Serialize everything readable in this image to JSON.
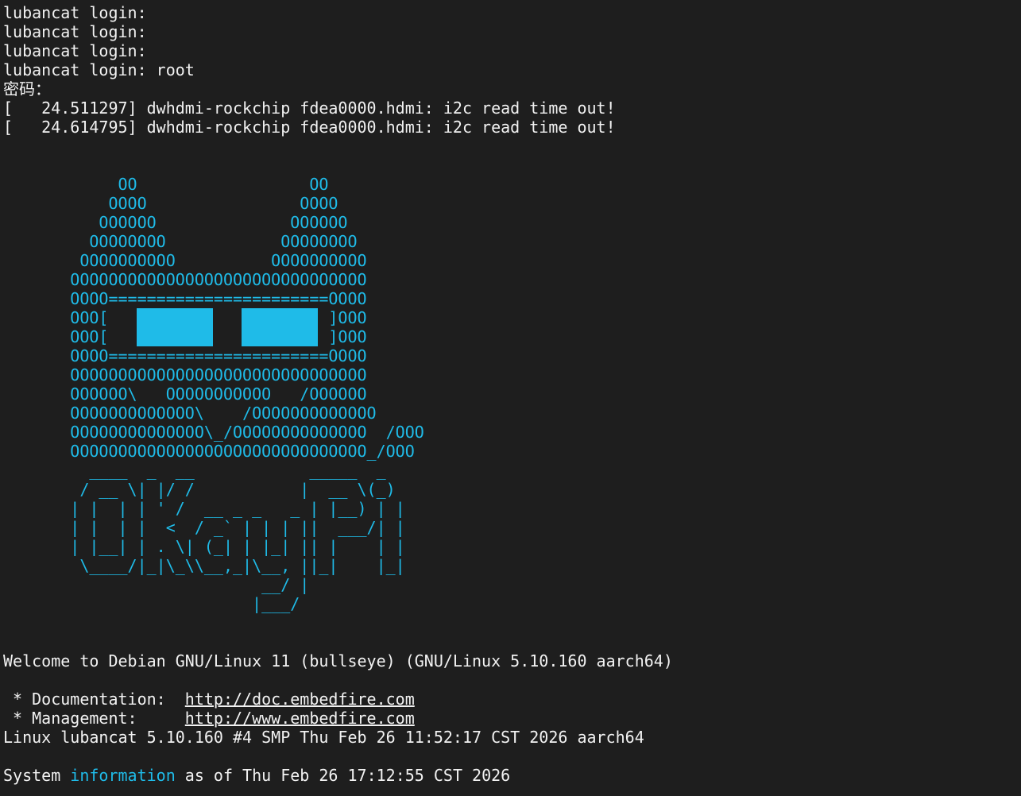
{
  "login": {
    "lines": [
      "lubancat login:",
      "lubancat login:",
      "lubancat login:",
      "lubancat login: root",
      "密码：",
      "[   24.511297] dwhdmi-rockchip fdea0000.hdmi: i2c read time out!",
      "[   24.614795] dwhdmi-rockchip fdea0000.hdmi: i2c read time out!"
    ]
  },
  "logo": {
    "color": "#1fbbe8",
    "lines": [
      "            OO                  OO",
      "           OOOO                OOOO",
      "          OOOOOO              OOOOOO",
      "         OOOOOOOO            OOOOOOOO",
      "        OOOOOOOOOO          OOOOOOOOOO",
      "       OOOOOOOOOOOOOOOOOOOOOOOOOOOOOOO",
      "       OOOO=======================OOOO",
      "       OOO[                       ]OOO",
      "       OOO[                       ]OOO",
      "       OOOO=======================OOOO",
      "       OOOOOOOOOOOOOOOOOOOOOOOOOOOOOOO",
      "       OOOOOO\\   OOOOOOOOOOO   /OOOOOO",
      "       OOOOOOOOOOOOO\\    /OOOOOOOOOOOOO",
      "       OOOOOOOOOOOOOO\\_/OOOOOOOOOOOOOO  /OOO",
      "       OOOOOOOOOOOOOOOOOOOOOOOOOOOOOOO_/OOO",
      "         ____  _  __            _____  _",
      "        / __ \\| |/ /           |  __ \\(_)",
      "       | |  | | ' /  __ _ _   _ | |__) | |",
      "       | |  | |  <  / _` | | | ||  ___/| |",
      "       | |__| | . \\| (_| | |_| || |    | |",
      "        \\____/|_|\\_\\\\__,_|\\__, ||_|    |_|",
      "                           __/ |",
      "                          |___/"
    ]
  },
  "welcome": {
    "text": "Welcome to Debian GNU/Linux 11 (bullseye) (GNU/Linux 5.10.160 aarch64)",
    "documentation_label": " * Documentation:  ",
    "documentation_url": "http://doc.embedfire.com",
    "management_label": " * Management:     ",
    "management_url": "http://www.embedfire.com",
    "uname": "Linux lubancat 5.10.160 #4 SMP Thu Feb 26 11:52:17 CST 2026 aarch64",
    "sysinfo_prefix": "System ",
    "sysinfo_keyword": "information",
    "sysinfo_suffix": " as of Thu Feb 26 17:12:55 CST 2026"
  }
}
